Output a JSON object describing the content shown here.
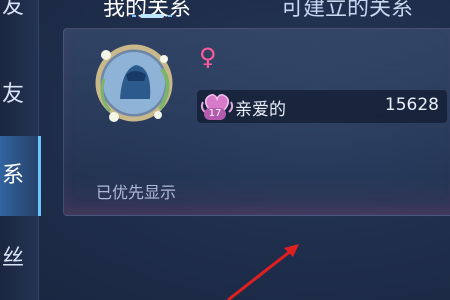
{
  "sidebar": {
    "items": [
      {
        "label": "友"
      },
      {
        "label": "友"
      },
      {
        "label": "系"
      },
      {
        "label": "丝"
      }
    ]
  },
  "tabs": [
    {
      "label": "我的关系"
    },
    {
      "label": "可建立的关系"
    }
  ],
  "card": {
    "gender_symbol": "♀",
    "relationship": {
      "level": "17",
      "name": "亲爱的",
      "score": "15628"
    },
    "pinned_text": "已优先显示"
  },
  "icons": [
    "avatar-frame",
    "female-icon",
    "heart-relationship-icon",
    "red-arrow-annotation"
  ],
  "colors": {
    "accent": "#6cc6ff",
    "gender": "#ff5a9a",
    "level_badge": "#b45bb0",
    "arrow": "#e02020"
  }
}
